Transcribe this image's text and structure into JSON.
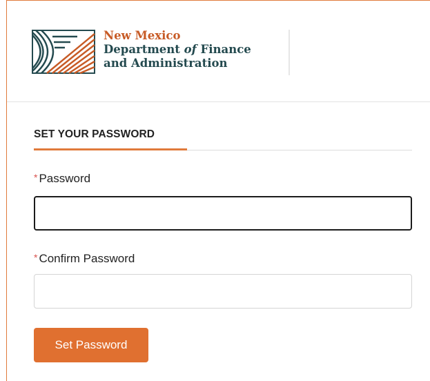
{
  "brand": {
    "line1": "New Mexico",
    "line2_pre": "Department ",
    "line2_of": "of",
    "line2_post": " Finance",
    "line3": "and Administration",
    "logo_icon": "nm-dfa-logo-icon"
  },
  "form": {
    "title": "SET YOUR PASSWORD",
    "required_marker": "*",
    "password_label": "Password",
    "password_value": "",
    "confirm_label": "Confirm Password",
    "confirm_value": "",
    "submit_label": "Set Password"
  },
  "colors": {
    "accent": "#e07030",
    "brand_orange": "#c75b26",
    "brand_teal": "#244a4f",
    "required": "#d9534f"
  }
}
